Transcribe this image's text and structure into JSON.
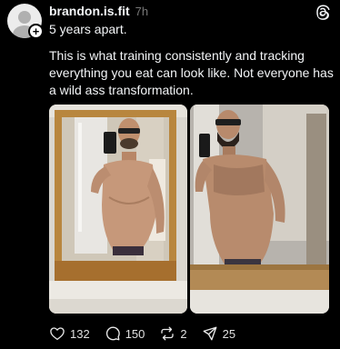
{
  "post": {
    "username": "brandon.is.fit",
    "timestamp": "7h",
    "subline": "5 years apart.",
    "text": "This is what training consistently and tracking everything you eat can look like. Not everyone has a wild ass transformation.",
    "follow_symbol": "+",
    "app_icon": "threads-icon"
  },
  "actions": {
    "likes": "132",
    "replies": "150",
    "reposts": "2",
    "shares": "25"
  },
  "icons": [
    "heart-icon",
    "comment-icon",
    "repost-icon",
    "share-icon"
  ]
}
